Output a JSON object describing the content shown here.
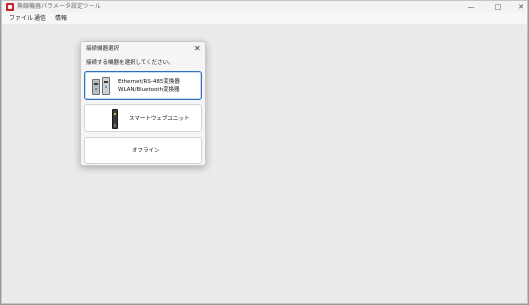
{
  "window": {
    "title": "無線機器パラメータ設定ツール",
    "controls": {
      "minimize": "—",
      "maximize": "□",
      "close": "✕"
    }
  },
  "menubar": {
    "items": [
      "ファイル",
      "通信",
      "情報"
    ]
  },
  "dialog": {
    "title": "接続機器選択",
    "close": "✕",
    "prompt": "接続する機器を選択してください。",
    "options": [
      {
        "line1": "Ethernet/RS-485変換器",
        "line2": "WLAN/Bluetooth変換器",
        "icon": "converter-devices-icon"
      },
      {
        "line1": "スマートウェブユニット",
        "icon": "smart-web-unit-icon"
      },
      {
        "line1": "オフライン"
      }
    ]
  },
  "colors": {
    "app_icon": "#c8242b",
    "selected_border": "#2f6fc2"
  }
}
